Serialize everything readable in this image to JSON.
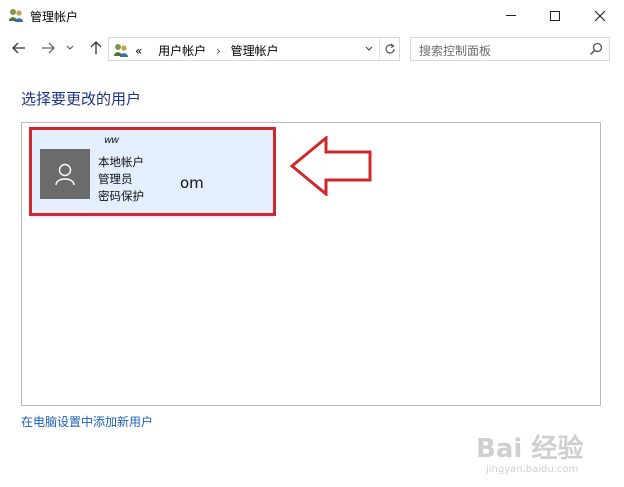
{
  "window": {
    "title": "管理帐户",
    "icon": "users-icon"
  },
  "nav": {
    "breadcrumb_prefix": "«",
    "breadcrumb": [
      "用户帐户",
      "管理帐户"
    ],
    "breadcrumb_sep": "›",
    "search_placeholder": "搜索控制面板"
  },
  "main": {
    "heading": "选择要更改的用户",
    "user": {
      "name": "ww",
      "type": "本地帐户",
      "role": "管理员",
      "protection": "密码保护",
      "email_fragment": "om"
    },
    "add_link": "在电脑设置中添加新用户"
  },
  "annotation": {
    "color": "#d0272d"
  },
  "watermark": {
    "text": "Bai 经验",
    "url": "jingyan.baidu.com"
  }
}
